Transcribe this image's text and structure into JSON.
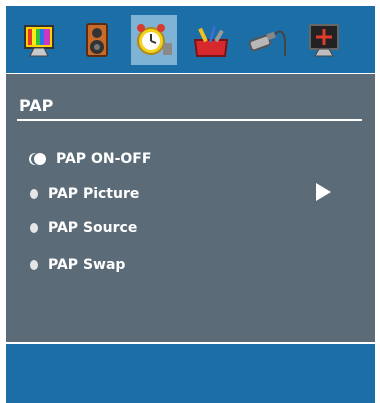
{
  "menu": {
    "title": "PAP",
    "tabs": [
      {
        "icon": "tv-picture-icon"
      },
      {
        "icon": "speaker-icon"
      },
      {
        "icon": "alarm-clock-icon",
        "active": true
      },
      {
        "icon": "toolbox-icon"
      },
      {
        "icon": "connector-cable-icon"
      },
      {
        "icon": "pc-monitor-icon"
      }
    ],
    "items": [
      {
        "label": "PAP ON-OFF"
      },
      {
        "label": "PAP Picture"
      },
      {
        "label": "PAP Source"
      },
      {
        "label": "PAP Swap"
      }
    ]
  },
  "colors": {
    "bar": "#1b6fa6",
    "panel": "#5b6c78",
    "active_tab": "#7fb3d6"
  }
}
